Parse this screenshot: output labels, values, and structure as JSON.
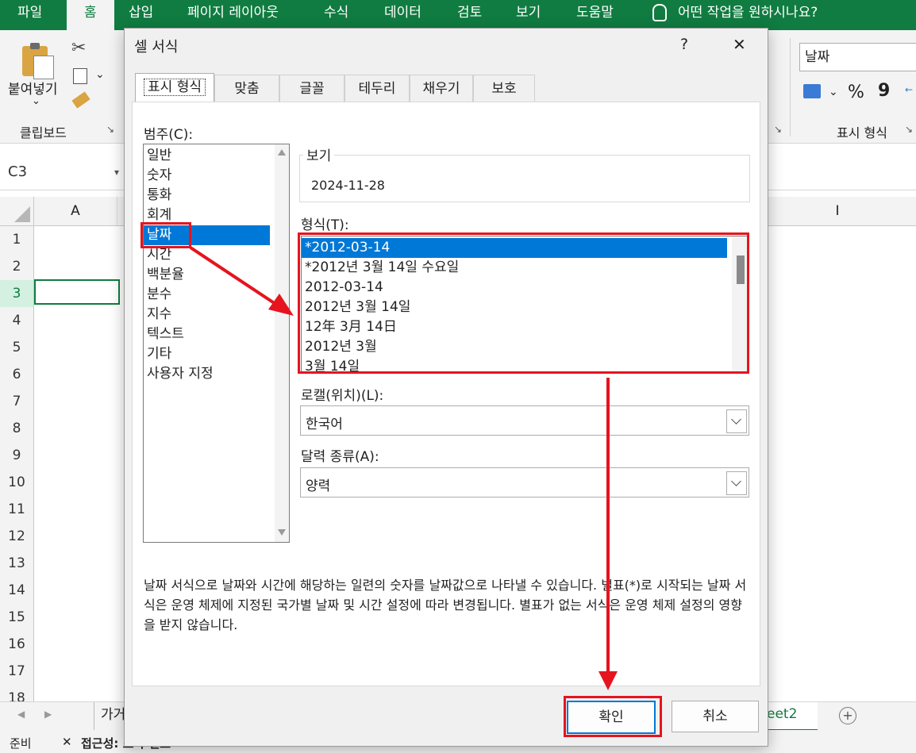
{
  "ribbon": {
    "tabs": [
      "파일",
      "홈",
      "삽입",
      "페이지 레이아웃",
      "수식",
      "데이터",
      "검토",
      "보기",
      "도움말"
    ],
    "active_tab": "홈",
    "tell_me": "어떤 작업을 원하시나요?",
    "paste_label": "붙여넣기",
    "clipboard_group": "클립보드",
    "number_format_value": "날짜",
    "number_group": "표시 형식",
    "percent_symbol": "%",
    "comma_symbol": "9"
  },
  "formula_bar": {
    "name_box": "C3"
  },
  "grid": {
    "column_a": "A",
    "column_i": "I",
    "rows": [
      "1",
      "2",
      "3",
      "4",
      "5",
      "6",
      "7",
      "8",
      "9",
      "10",
      "11",
      "12",
      "13",
      "14",
      "15",
      "16",
      "17",
      "18"
    ],
    "active_row": "3"
  },
  "sheet_tabs": {
    "partial_left": "가거",
    "partial_right": "eet2"
  },
  "status_bar": {
    "ready": "준비",
    "accessibility": "접근성: 조사 필요"
  },
  "dialog": {
    "title": "셀 서식",
    "help": "?",
    "close": "✕",
    "tabs": [
      "표시 형식",
      "맞춤",
      "글꼴",
      "테두리",
      "채우기",
      "보호"
    ],
    "category_label": "범주(C):",
    "categories": [
      "일반",
      "숫자",
      "통화",
      "회계",
      "날짜",
      "시간",
      "백분율",
      "분수",
      "지수",
      "텍스트",
      "기타",
      "사용자 지정"
    ],
    "selected_category": "날짜",
    "sample_label": "보기",
    "sample_value": "2024-11-28",
    "type_label": "형식(T):",
    "types": [
      "*2012-03-14",
      "*2012년 3월 14일 수요일",
      "2012-03-14",
      "2012년 3월 14일",
      "12年 3月 14日",
      "2012년 3월",
      "3월 14일"
    ],
    "selected_type": "*2012-03-14",
    "locale_label": "로캘(위치)(L):",
    "locale_value": "한국어",
    "calendar_label": "달력 종류(A):",
    "calendar_value": "양력",
    "description": "날짜 서식으로 날짜와 시간에 해당하는 일련의 숫자를 날짜값으로 나타낼 수 있습니다. 별표(*)로 시작되는 날짜 서식은 운영 체제에 지정된 국가별 날짜 및 시간 설정에 따라 변경됩니다. 별표가 없는 서식은 운영 체제 설정의 영향을 받지 않습니다.",
    "ok": "확인",
    "cancel": "취소"
  },
  "colors": {
    "excel_green": "#107c41",
    "selection_blue": "#0078d7",
    "annotation_red": "#e5141f"
  }
}
